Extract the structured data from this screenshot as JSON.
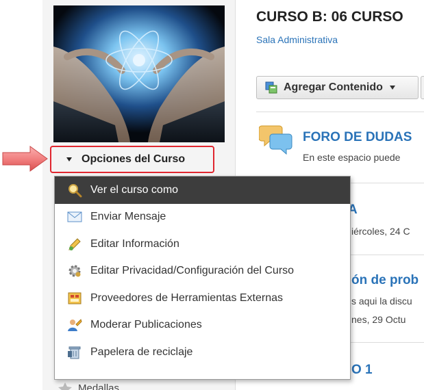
{
  "course": {
    "title": "CURSO B: 06 CURSO",
    "subtitle": "Sala Administrativa"
  },
  "toolbar": {
    "add_content_label": "Agregar Contenido",
    "add_content_icon": "add-content-icon"
  },
  "sidebar": {
    "options_label": "Opciones del Curso",
    "bottom_item_label": "Medallas"
  },
  "options_menu": {
    "items": [
      {
        "label": "Ver el curso como",
        "icon": "magnifier-icon",
        "active": true
      },
      {
        "label": "Enviar Mensaje",
        "icon": "envelope-icon",
        "active": false
      },
      {
        "label": "Editar Información",
        "icon": "pencil-icon",
        "active": false
      },
      {
        "label": "Editar Privacidad/Configuración del Curso",
        "icon": "gear-icon",
        "active": false
      },
      {
        "label": "Proveedores de Herramientas Externas",
        "icon": "tools-icon",
        "active": false
      },
      {
        "label": "Moderar Publicaciones",
        "icon": "moderate-icon",
        "active": false
      },
      {
        "label": "Papelera de reciclaje",
        "icon": "recycle-bin-icon",
        "active": false
      }
    ]
  },
  "content": {
    "forum": {
      "title": "FORO DE DUDAS",
      "description": "En este espacio puede"
    },
    "item2": {
      "title": "A",
      "meta": "iércoles, 24 C"
    },
    "item3": {
      "title": "ón de prob",
      "text": "s aqui la discu",
      "meta": "nes, 29 Octu"
    },
    "item4": {
      "title": "O 1"
    }
  },
  "colors": {
    "highlight_border": "#e0262f",
    "menu_active_bg": "#3d3d3d",
    "link_blue": "#2a73b8",
    "arrow_fill": "#f07c7c"
  }
}
